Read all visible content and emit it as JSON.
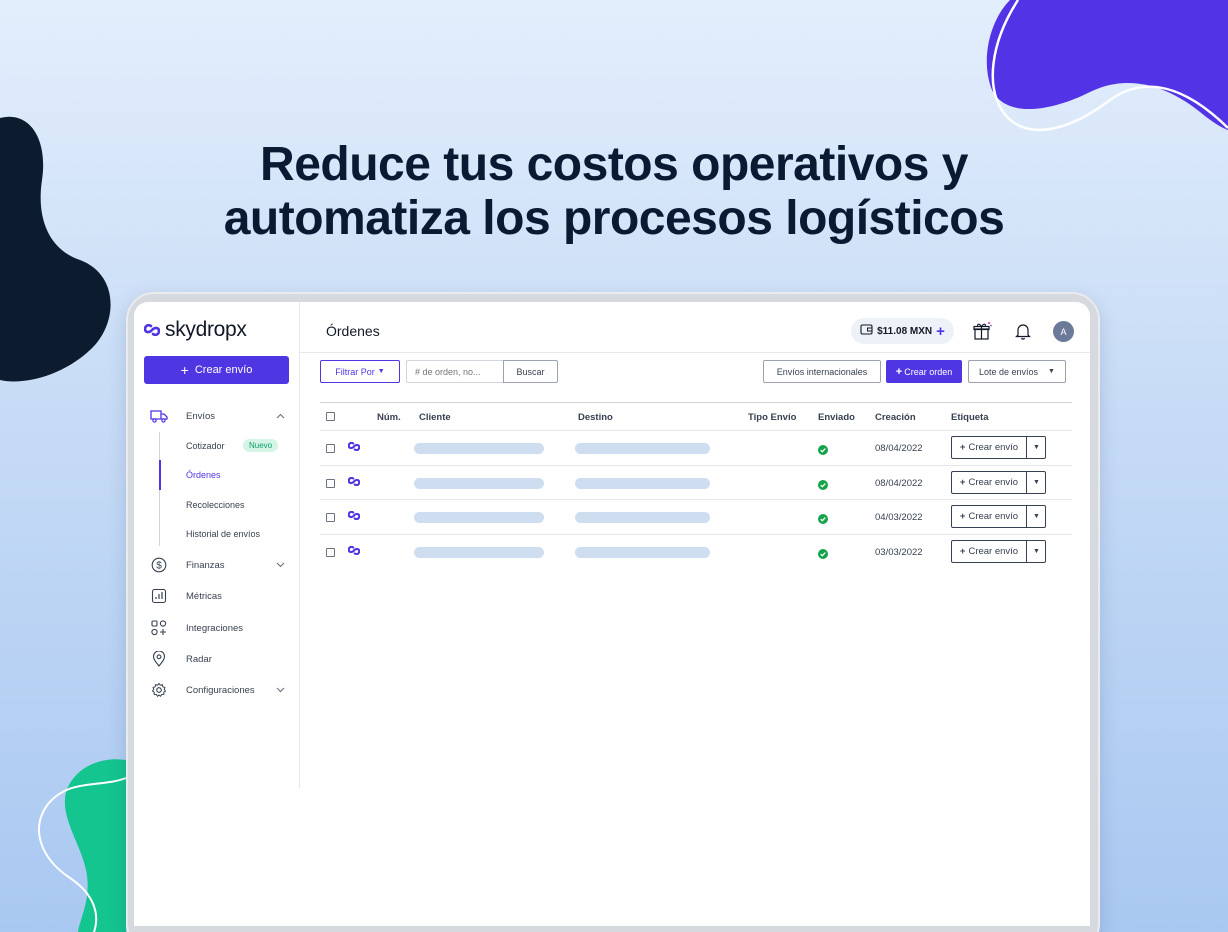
{
  "headline": {
    "line1": "Reduce tus costos operativos y",
    "line2": "automatiza los procesos logísticos"
  },
  "brand": {
    "name": "skydropx",
    "accent": "#4f36e3"
  },
  "sidebar": {
    "create_button": "Crear envío",
    "items": [
      {
        "label": "Envíos",
        "icon": "truck-icon",
        "expanded": true
      },
      {
        "label": "Finanzas",
        "icon": "dollar-icon"
      },
      {
        "label": "Métricas",
        "icon": "chart-icon"
      },
      {
        "label": "Integraciones",
        "icon": "apps-icon"
      },
      {
        "label": "Radar",
        "icon": "location-pin-icon"
      },
      {
        "label": "Configuraciones",
        "icon": "gear-icon"
      }
    ],
    "subitems": [
      {
        "label": "Cotizador",
        "badge": "Nuevo"
      },
      {
        "label": "Órdenes",
        "active": true
      },
      {
        "label": "Recolecciones"
      },
      {
        "label": "Historial de envíos"
      }
    ]
  },
  "header": {
    "title": "Órdenes",
    "balance": "$11.08 MXN",
    "avatar_initial": "A"
  },
  "toolbar": {
    "filter": "Filtrar Por",
    "search_placeholder": "# de orden, no...",
    "search": "Buscar",
    "international": "Envíos internacionales",
    "create_order": "Crear orden",
    "batch": "Lote de envíos"
  },
  "table": {
    "columns": [
      "Núm.",
      "Cliente",
      "Destino",
      "Tipo Envío",
      "Enviado",
      "Creación",
      "Etiqueta"
    ],
    "rows": [
      {
        "date": "08/04/2022",
        "sent": true,
        "action": "Crear envío"
      },
      {
        "date": "08/04/2022",
        "sent": true,
        "action": "Crear envío"
      },
      {
        "date": "04/03/2022",
        "sent": true,
        "action": "Crear envío"
      },
      {
        "date": "03/03/2022",
        "sent": true,
        "action": "Crear envío"
      }
    ]
  }
}
